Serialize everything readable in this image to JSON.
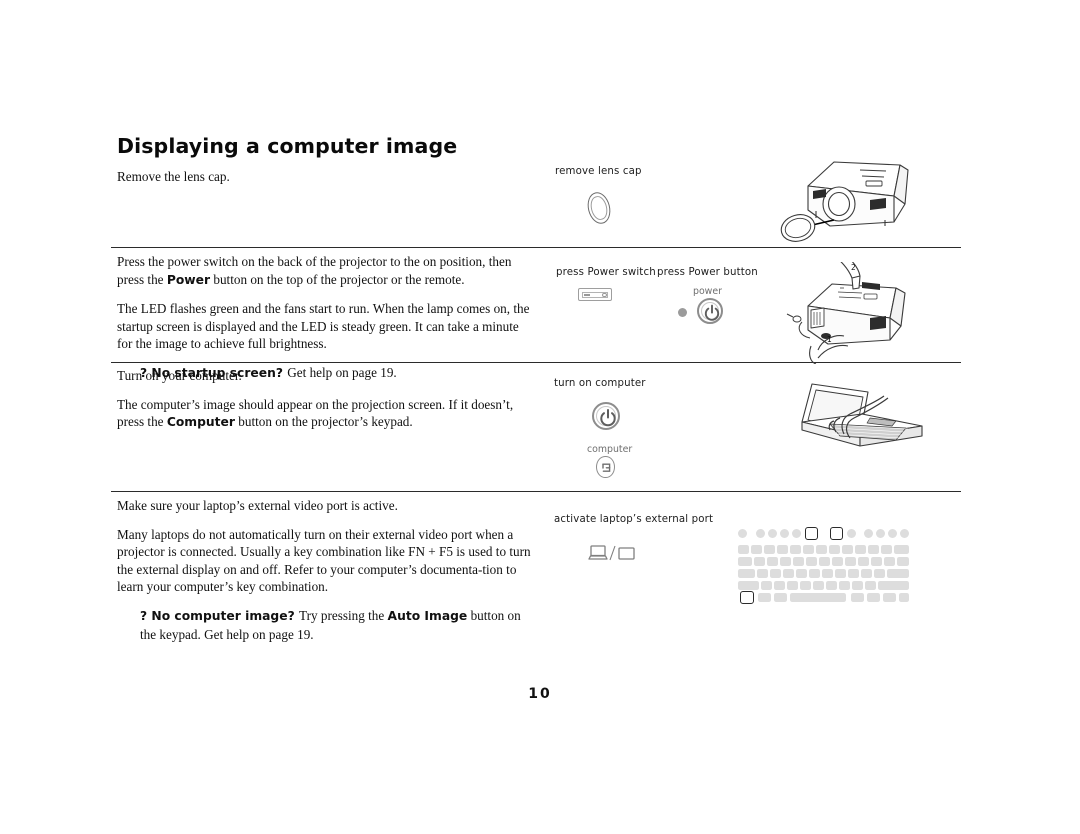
{
  "document": {
    "title": "Displaying a computer image",
    "page_number": "10"
  },
  "sections": [
    {
      "id": "remove-lens-cap",
      "paragraphs": [
        {
          "runs": [
            {
              "text": "Remove the lens cap.",
              "bold": false
            }
          ]
        }
      ],
      "callouts": [
        {
          "label": "remove lens cap"
        }
      ]
    },
    {
      "id": "power-on-projector",
      "paragraphs": [
        {
          "runs": [
            {
              "text": "Press the power switch on the back of the projector to the on position, then press the ",
              "bold": false
            },
            {
              "text": "Power",
              "bold": true
            },
            {
              "text": " button on the top of the projector or the remote.",
              "bold": false
            }
          ]
        },
        {
          "runs": [
            {
              "text": "The LED flashes green and the fans start to run. When the lamp comes on, the startup screen is displayed and the LED is steady green. It can take a minute for the image to achieve full brightness.",
              "bold": false
            }
          ]
        },
        {
          "tip": true,
          "runs": [
            {
              "text": "? No startup screen? ",
              "bold": true
            },
            {
              "text": "Get help on page 19.",
              "bold": false
            }
          ]
        }
      ],
      "callouts": [
        {
          "label": "press Power switch"
        },
        {
          "label": "press Power button"
        },
        {
          "label": "power"
        }
      ]
    },
    {
      "id": "turn-on-computer",
      "paragraphs": [
        {
          "runs": [
            {
              "text": "Turn on your computer.",
              "bold": false
            }
          ]
        },
        {
          "runs": [
            {
              "text": "The computer’s image should appear on the projection screen. If it doesn’t, press the ",
              "bold": false
            },
            {
              "text": "Computer",
              "bold": true
            },
            {
              "text": " button on the projector’s keypad.",
              "bold": false
            }
          ]
        }
      ],
      "callouts": [
        {
          "label": "turn on computer"
        },
        {
          "label": "computer"
        }
      ]
    },
    {
      "id": "activate-external-port",
      "paragraphs": [
        {
          "runs": [
            {
              "text": "Make sure your laptop’s external video port is active.",
              "bold": false
            }
          ]
        },
        {
          "runs": [
            {
              "text": "Many laptops do not automatically turn on their external video port when a projector is connected. Usually a key combination like FN + F5 is used to turn the external display on and off. Refer to your computer’s documenta-tion to learn your computer’s key combination.",
              "bold": false
            }
          ]
        },
        {
          "tip": true,
          "runs": [
            {
              "text": "? No computer image? ",
              "bold": true
            },
            {
              "text": "Try pressing the ",
              "bold": false
            },
            {
              "text": "Auto Image",
              "bold": true
            },
            {
              "text": " button on the keypad. Get help on page 19.",
              "bold": false
            }
          ]
        }
      ],
      "callouts": [
        {
          "label": "activate laptop’s external port"
        }
      ]
    }
  ],
  "illustrations": [
    {
      "name": "projector-lens-cap-removal"
    },
    {
      "name": "projector-rear-power-switch",
      "step_markers": [
        "1",
        "2"
      ]
    },
    {
      "name": "laptop-open-typing"
    },
    {
      "name": "laptop-keyboard-fn-keys"
    }
  ],
  "colors": {
    "text": "#111111",
    "rule": "#2b2b2b",
    "icon_outline": "#8d8d8d",
    "key_fill": "#dddddd",
    "caption": "#1d1d1d"
  }
}
